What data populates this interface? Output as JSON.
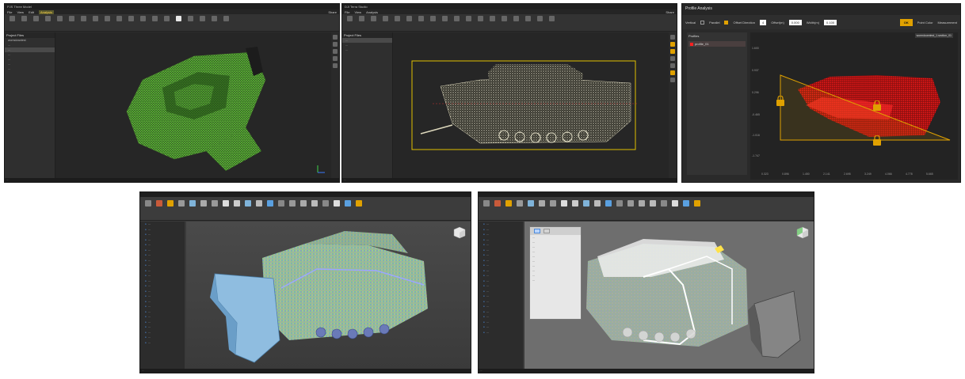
{
  "panel1": {
    "title": "PJS Three Model",
    "menu": [
      "File",
      "View",
      "Edit",
      "Analysis"
    ],
    "active_menu": "Analysis",
    "share_label": "Share",
    "panel_header": "Project Files",
    "tree": [
      "wormdowntest",
      "...",
      "...",
      "...",
      "...",
      "...",
      "..."
    ],
    "status": "..."
  },
  "panel2": {
    "title": "DJI Terra Studio",
    "menu": [
      "File",
      "View",
      "Analysis"
    ],
    "share_label": "Share",
    "panel_header": "Project Files",
    "tree": [
      "...",
      "...",
      "..."
    ],
    "status": "..."
  },
  "panel3": {
    "title": "Profile Analysis",
    "vertical_label": "Vertical",
    "parallel_label": "Parallel",
    "offset_direction_label": "Offset Direction",
    "offset_direction_value": "4",
    "offset_label": "Offset(m)",
    "offset_value": "0.000",
    "width_label": "Width(m)",
    "width_value": "0.100",
    "ok_label": "OK",
    "point_color_label": "Point Color",
    "measurement_label": "Measurement",
    "profiles_header": "Profiles",
    "profile_item": "profile_01",
    "section_label": "wormdowntest_1.section_01",
    "y_ticks": [
      "1.600",
      "0.937",
      "0.296",
      "-0.465",
      "-1.016",
      "-1.747"
    ],
    "x_ticks": [
      "0.323",
      "0.896",
      "1.450",
      "2.141",
      "2.695",
      "3.249",
      "4.066",
      "4.778",
      "5.665"
    ]
  },
  "panel4": {
    "tree_rows": [
      "...",
      "...",
      "...",
      "...",
      "...",
      "...",
      "...",
      "...",
      "...",
      "...",
      "...",
      "...",
      "...",
      "...",
      "...",
      "...",
      "...",
      "...",
      "...",
      "...",
      "...",
      "...",
      "...",
      "..."
    ],
    "status": "..."
  },
  "panel5": {
    "tree_rows": [
      "...",
      "...",
      "...",
      "...",
      "...",
      "...",
      "...",
      "...",
      "...",
      "...",
      "...",
      "...",
      "...",
      "...",
      "...",
      "...",
      "...",
      "...",
      "...",
      "...",
      "...",
      "..."
    ],
    "dialog_rows": [
      "...",
      "...",
      "...",
      "...",
      "...",
      "...",
      "...",
      "...",
      "...",
      "..."
    ],
    "status": "..."
  },
  "colors": {
    "accent": "#e0a100",
    "point_green": "#4caf30",
    "profile_red": "#ff1a1a",
    "mesh_blue": "#7fb3d9"
  }
}
